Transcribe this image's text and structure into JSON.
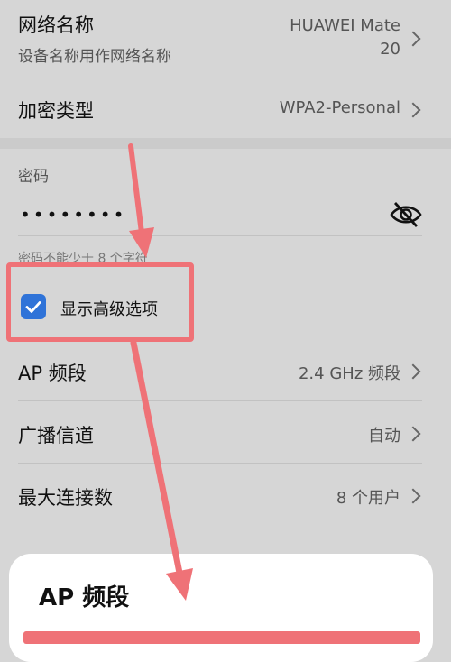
{
  "network_name": {
    "title": "网络名称",
    "subtitle": "设备名称用作网络名称",
    "value_line1": "HUAWEI Mate",
    "value_line2": "20"
  },
  "encryption": {
    "title": "加密类型",
    "value": "WPA2-Personal"
  },
  "password": {
    "label": "密码",
    "masked_value": "••••••••",
    "hint": "密码不能少于 8 个字符",
    "visibility_icon": "eye-off-icon"
  },
  "advanced": {
    "label": "显示高级选项",
    "checked": true
  },
  "ap_band": {
    "title": "AP 频段",
    "value": "2.4 GHz 频段"
  },
  "broadcast_channel": {
    "title": "广播信道",
    "value": "自动"
  },
  "max_connections": {
    "title": "最大连接数",
    "value": "8 个用户"
  },
  "sheet": {
    "title": "AP 频段"
  },
  "colors": {
    "accent": "#2f73d8",
    "annotation": "#ef7277",
    "background": "#d6d6d6"
  }
}
